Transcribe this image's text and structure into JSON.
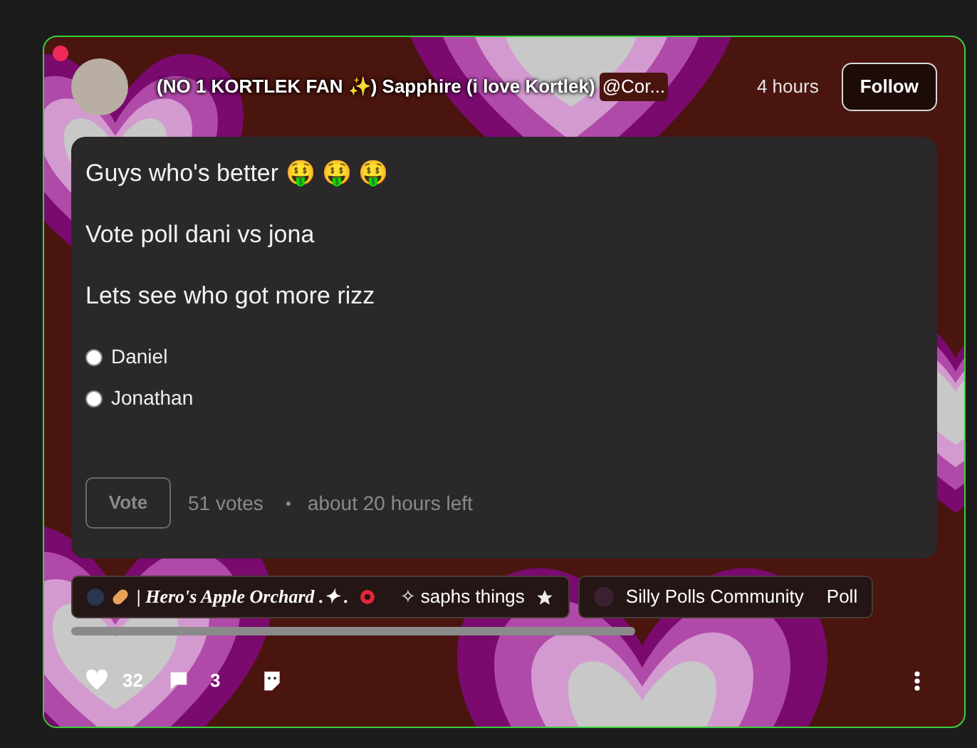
{
  "post": {
    "author": "(NO 1 KORTLEK FAN ✨) Sapphire (i love Kortlek)",
    "handle": "@Cor...",
    "time": "4 hours",
    "follow": "Follow",
    "body": [
      "Guys who's better 🤑 🤑 🤑",
      "Vote poll dani vs jona",
      "Lets see who got more rizz"
    ],
    "poll": {
      "options": [
        {
          "label": "Daniel",
          "selected": false
        },
        {
          "label": "Jonathan",
          "selected": false
        }
      ],
      "vote": "Vote",
      "votes": "51 votes",
      "remaining": "about 20 hours left"
    },
    "tags": [
      {
        "kind": "space",
        "label": "| Hero's Apple Orchard .✦ .",
        "extra": "✧ saphs things"
      },
      {
        "kind": "community",
        "label": "Silly Polls Community",
        "extra": "Poll"
      }
    ],
    "actions": {
      "likes": "32",
      "comments": "3"
    }
  }
}
